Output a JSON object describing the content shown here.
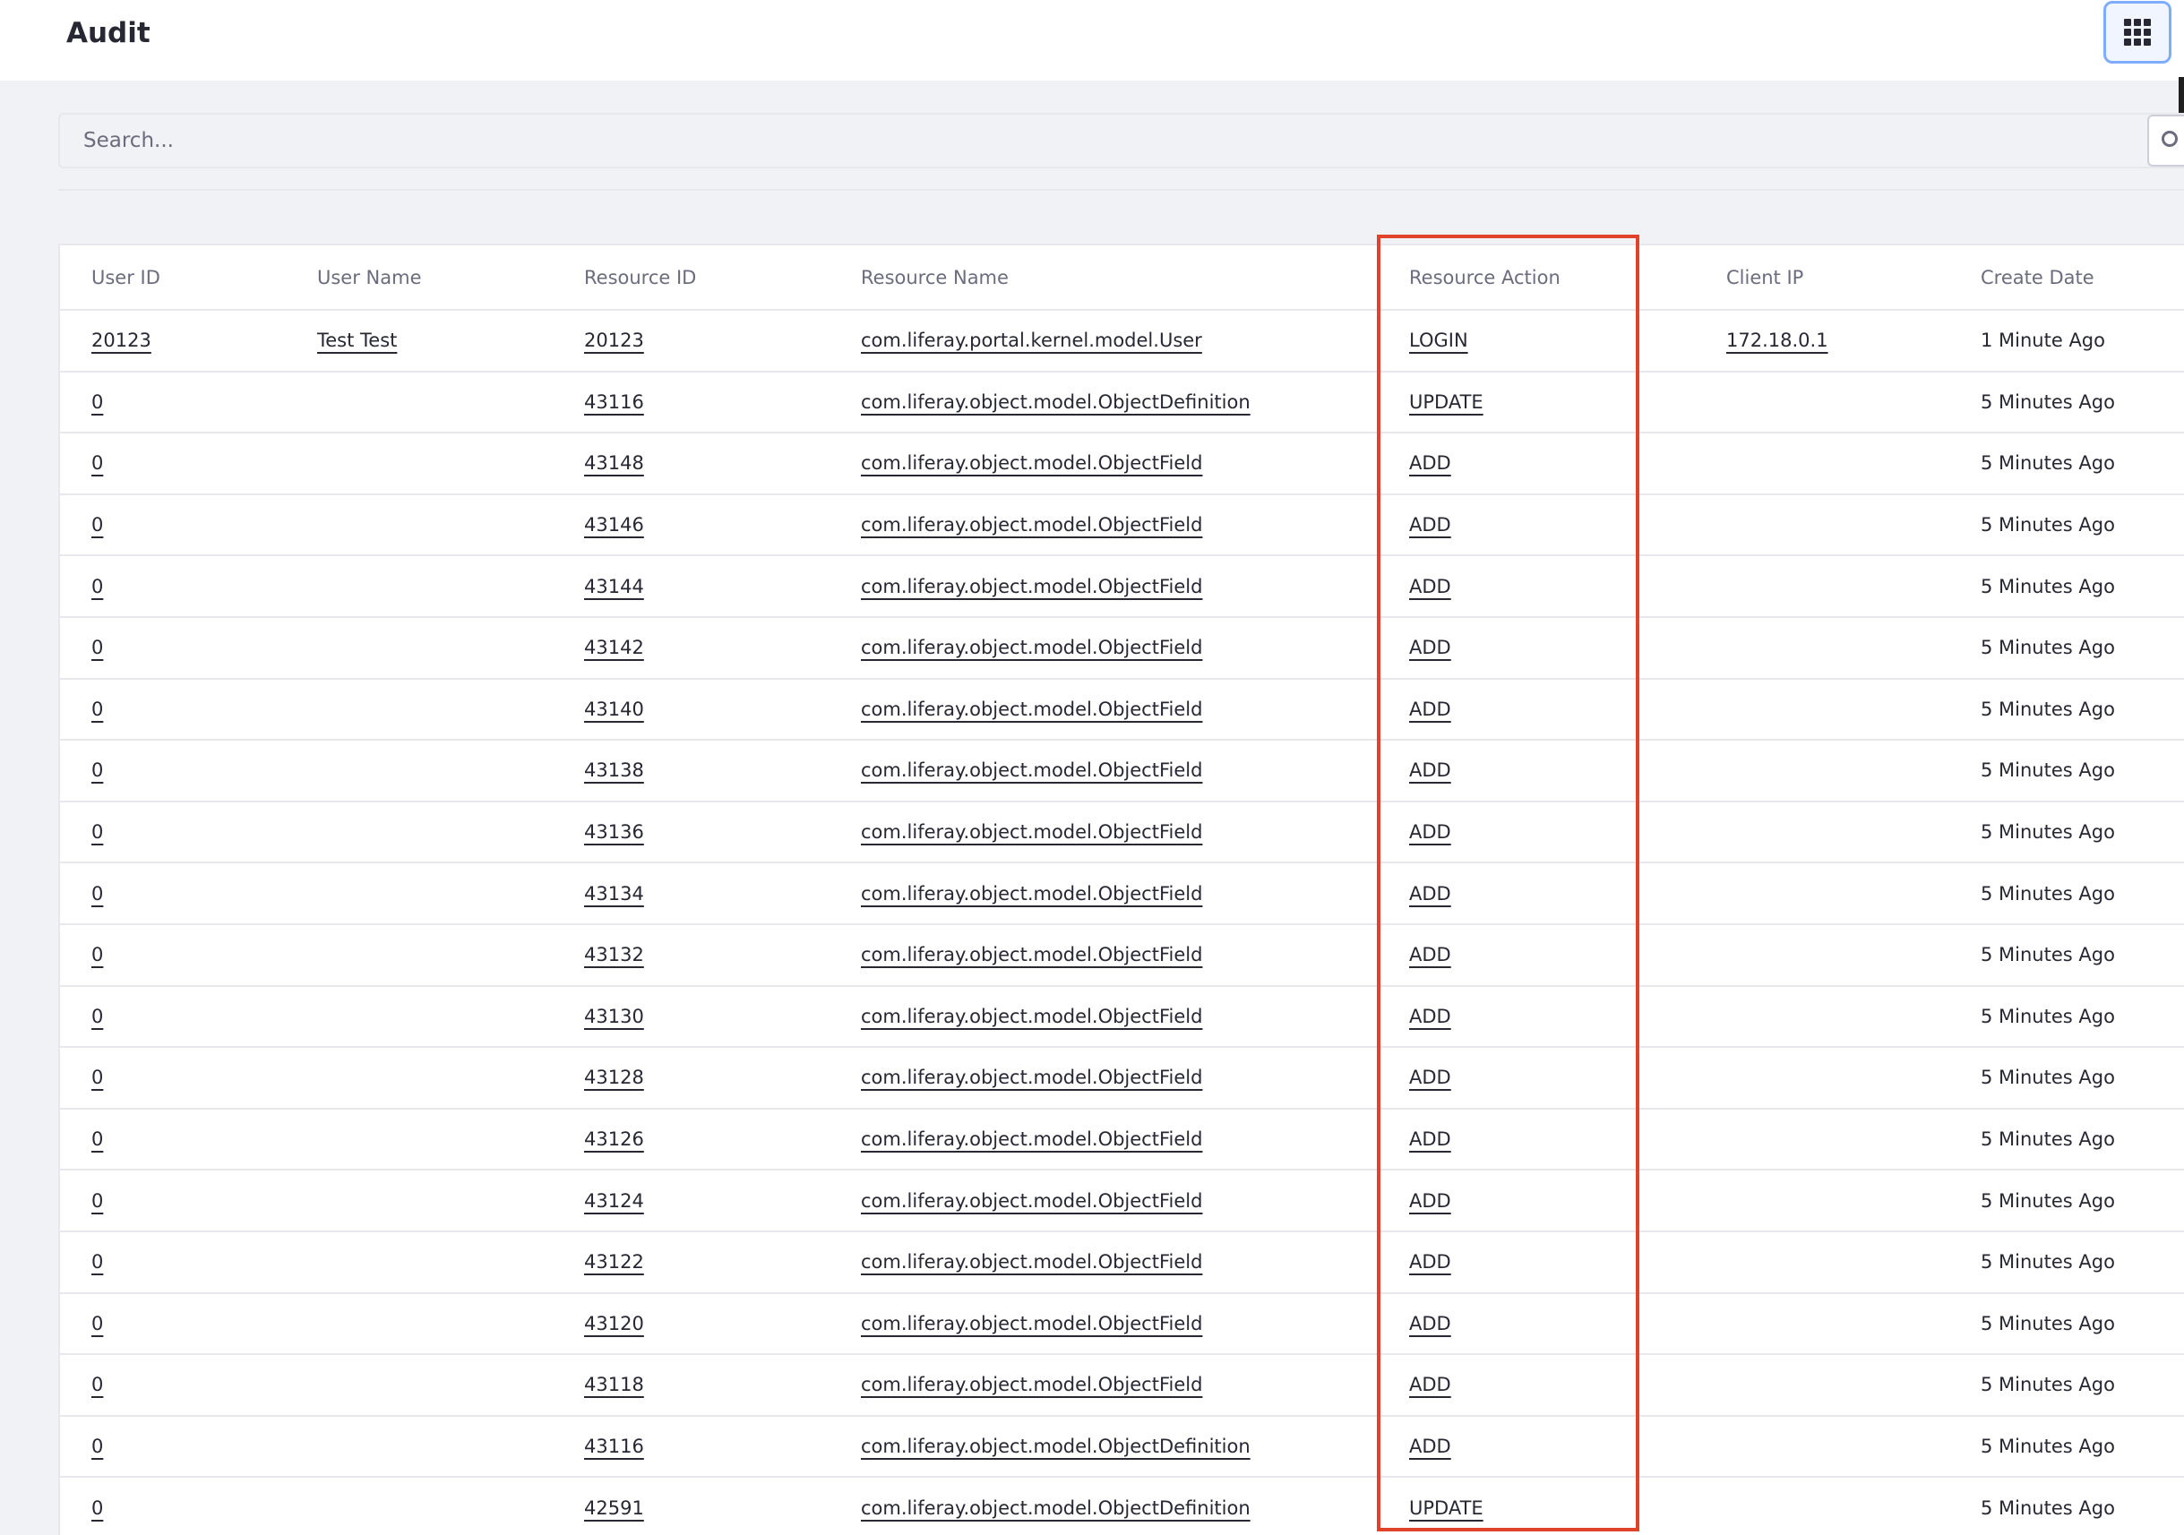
{
  "header": {
    "title": "Audit",
    "apps_icon": "apps-grid-icon"
  },
  "search": {
    "placeholder": "Search...",
    "value": "",
    "icon": "search-icon"
  },
  "table": {
    "columns": [
      "User ID",
      "User Name",
      "Resource ID",
      "Resource Name",
      "Resource Action",
      "Client IP",
      "Create Date"
    ],
    "rows": [
      {
        "user_id": "20123",
        "user_name": "Test Test",
        "resource_id": "20123",
        "resource_name": "com.liferay.portal.kernel.model.User",
        "action": "LOGIN",
        "client_ip": "172.18.0.1",
        "create_date": "1 Minute Ago"
      },
      {
        "user_id": "0",
        "user_name": "",
        "resource_id": "43116",
        "resource_name": "com.liferay.object.model.ObjectDefinition",
        "action": "UPDATE",
        "client_ip": "",
        "create_date": "5 Minutes Ago"
      },
      {
        "user_id": "0",
        "user_name": "",
        "resource_id": "43148",
        "resource_name": "com.liferay.object.model.ObjectField",
        "action": "ADD",
        "client_ip": "",
        "create_date": "5 Minutes Ago"
      },
      {
        "user_id": "0",
        "user_name": "",
        "resource_id": "43146",
        "resource_name": "com.liferay.object.model.ObjectField",
        "action": "ADD",
        "client_ip": "",
        "create_date": "5 Minutes Ago"
      },
      {
        "user_id": "0",
        "user_name": "",
        "resource_id": "43144",
        "resource_name": "com.liferay.object.model.ObjectField",
        "action": "ADD",
        "client_ip": "",
        "create_date": "5 Minutes Ago"
      },
      {
        "user_id": "0",
        "user_name": "",
        "resource_id": "43142",
        "resource_name": "com.liferay.object.model.ObjectField",
        "action": "ADD",
        "client_ip": "",
        "create_date": "5 Minutes Ago"
      },
      {
        "user_id": "0",
        "user_name": "",
        "resource_id": "43140",
        "resource_name": "com.liferay.object.model.ObjectField",
        "action": "ADD",
        "client_ip": "",
        "create_date": "5 Minutes Ago"
      },
      {
        "user_id": "0",
        "user_name": "",
        "resource_id": "43138",
        "resource_name": "com.liferay.object.model.ObjectField",
        "action": "ADD",
        "client_ip": "",
        "create_date": "5 Minutes Ago"
      },
      {
        "user_id": "0",
        "user_name": "",
        "resource_id": "43136",
        "resource_name": "com.liferay.object.model.ObjectField",
        "action": "ADD",
        "client_ip": "",
        "create_date": "5 Minutes Ago"
      },
      {
        "user_id": "0",
        "user_name": "",
        "resource_id": "43134",
        "resource_name": "com.liferay.object.model.ObjectField",
        "action": "ADD",
        "client_ip": "",
        "create_date": "5 Minutes Ago"
      },
      {
        "user_id": "0",
        "user_name": "",
        "resource_id": "43132",
        "resource_name": "com.liferay.object.model.ObjectField",
        "action": "ADD",
        "client_ip": "",
        "create_date": "5 Minutes Ago"
      },
      {
        "user_id": "0",
        "user_name": "",
        "resource_id": "43130",
        "resource_name": "com.liferay.object.model.ObjectField",
        "action": "ADD",
        "client_ip": "",
        "create_date": "5 Minutes Ago"
      },
      {
        "user_id": "0",
        "user_name": "",
        "resource_id": "43128",
        "resource_name": "com.liferay.object.model.ObjectField",
        "action": "ADD",
        "client_ip": "",
        "create_date": "5 Minutes Ago"
      },
      {
        "user_id": "0",
        "user_name": "",
        "resource_id": "43126",
        "resource_name": "com.liferay.object.model.ObjectField",
        "action": "ADD",
        "client_ip": "",
        "create_date": "5 Minutes Ago"
      },
      {
        "user_id": "0",
        "user_name": "",
        "resource_id": "43124",
        "resource_name": "com.liferay.object.model.ObjectField",
        "action": "ADD",
        "client_ip": "",
        "create_date": "5 Minutes Ago"
      },
      {
        "user_id": "0",
        "user_name": "",
        "resource_id": "43122",
        "resource_name": "com.liferay.object.model.ObjectField",
        "action": "ADD",
        "client_ip": "",
        "create_date": "5 Minutes Ago"
      },
      {
        "user_id": "0",
        "user_name": "",
        "resource_id": "43120",
        "resource_name": "com.liferay.object.model.ObjectField",
        "action": "ADD",
        "client_ip": "",
        "create_date": "5 Minutes Ago"
      },
      {
        "user_id": "0",
        "user_name": "",
        "resource_id": "43118",
        "resource_name": "com.liferay.object.model.ObjectField",
        "action": "ADD",
        "client_ip": "",
        "create_date": "5 Minutes Ago"
      },
      {
        "user_id": "0",
        "user_name": "",
        "resource_id": "43116",
        "resource_name": "com.liferay.object.model.ObjectDefinition",
        "action": "ADD",
        "client_ip": "",
        "create_date": "5 Minutes Ago"
      },
      {
        "user_id": "0",
        "user_name": "",
        "resource_id": "42591",
        "resource_name": "com.liferay.object.model.ObjectDefinition",
        "action": "UPDATE",
        "client_ip": "",
        "create_date": "5 Minutes Ago"
      }
    ]
  },
  "colors": {
    "highlight": "#e0432c",
    "page_background": "#f1f2f5",
    "focus_ring": "#80acff"
  }
}
